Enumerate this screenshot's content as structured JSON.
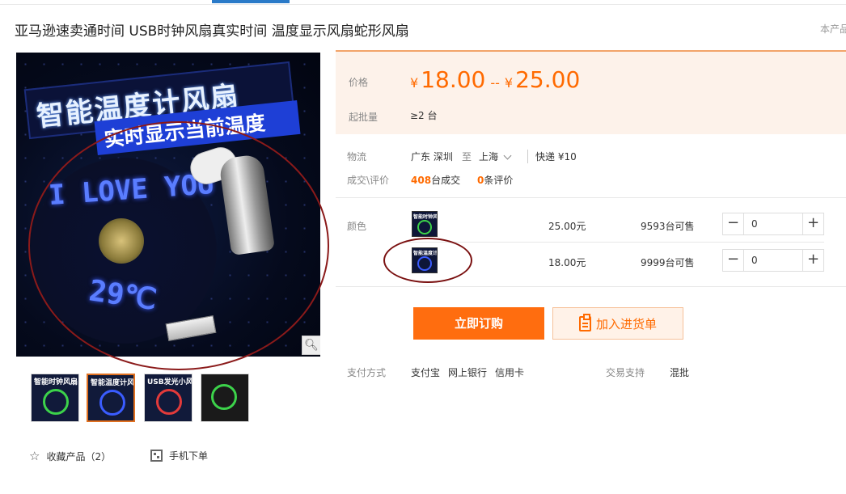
{
  "page": {
    "title": "亚马逊速卖通时间 USB时钟风扇真实时间 温度显示风扇蛇形风扇",
    "side_link": "本产品"
  },
  "main_image": {
    "banner_line1": "智能温度计风扇",
    "banner_line2": "实时显示当前温度",
    "led_text_1": "I LOVE YOU",
    "led_text_2": "29℃",
    "zoom_icon": "magnifier-icon"
  },
  "thumbnails": [
    {
      "caption": "智能时钟风扇",
      "ring_color": "#3cd24a",
      "active": false
    },
    {
      "caption": "智能温度计风扇",
      "ring_color": "#3a5cff",
      "active": true
    },
    {
      "caption": "USB发光小风扇",
      "ring_color": "#e23a3a",
      "active": false
    },
    {
      "caption": "",
      "ring_color": "#3cd24a",
      "active": false
    }
  ],
  "actions": {
    "favorite_label": "收藏产品（2）",
    "mobile_order_label": "手机下单"
  },
  "pricing": {
    "price_label": "价格",
    "currency": "¥",
    "price_min": "18.00",
    "separator": "--",
    "price_max": "25.00",
    "moq_label": "起批量",
    "moq_value": "≥2 台"
  },
  "logistics": {
    "label": "物流",
    "from": "广东 深圳",
    "to_word": "至",
    "to": "上海",
    "shipping": "快递 ¥10"
  },
  "trade": {
    "label": "成交\\评价",
    "deals_count": "408",
    "deals_suffix": "台成交",
    "reviews_count": "0",
    "reviews_suffix": "条评价"
  },
  "sku": {
    "color_label": "颜色",
    "rows": [
      {
        "price": "25.00元",
        "stock": "9593台可售",
        "qty": "0"
      },
      {
        "price": "18.00元",
        "stock": "9999台可售",
        "qty": "0"
      }
    ],
    "minus": "−",
    "plus": "+"
  },
  "buttons": {
    "buy_now": "立即订购",
    "add_to_list": "加入进货单"
  },
  "payment": {
    "label": "支付方式",
    "methods": [
      "支付宝",
      "网上银行",
      "信用卡"
    ],
    "support_label": "交易支持",
    "support_value": "混批"
  },
  "colors": {
    "accent": "#ff6a00",
    "price_bg": "#fdf2ea",
    "annotation": "#8b1a1a"
  }
}
